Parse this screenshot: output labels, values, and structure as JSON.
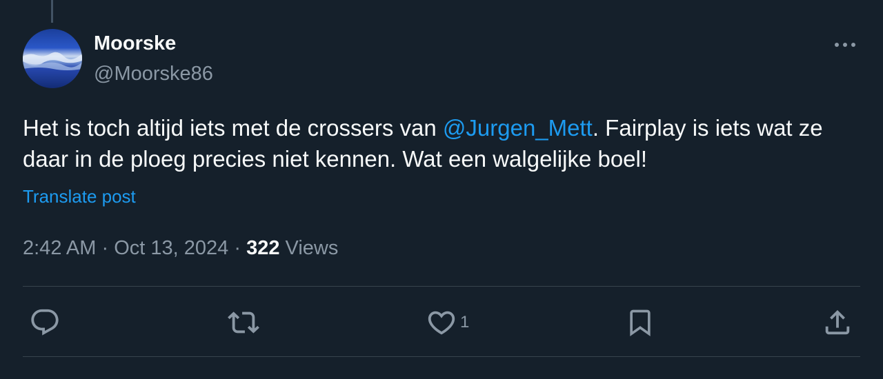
{
  "post": {
    "author": {
      "display_name": "Moorske",
      "handle": "@Moorske86",
      "avatar_icon": "avatar-image"
    },
    "more_icon": "more-horizontal-icon",
    "text": {
      "part1": "Het is toch altijd iets met de crossers van ",
      "mention": "@Jurgen_Mett",
      "part2": ". Fairplay is iets wat ze daar in de ploeg precies niet kennen. Wat een walgelijke boel!"
    },
    "translate_label": "Translate post",
    "meta": {
      "time": "2:42 AM",
      "separator": "·",
      "date": "Oct 13, 2024",
      "views_count": "322",
      "views_label": "Views"
    },
    "actions": {
      "reply_icon": "reply-icon",
      "repost_icon": "repost-icon",
      "like_icon": "like-icon",
      "like_count": "1",
      "bookmark_icon": "bookmark-icon",
      "share_icon": "share-icon"
    }
  },
  "colors": {
    "background": "#15202b",
    "text_primary": "#f7f9f9",
    "text_secondary": "#8b98a5",
    "accent": "#1d9bf0",
    "divider": "#38444d"
  }
}
